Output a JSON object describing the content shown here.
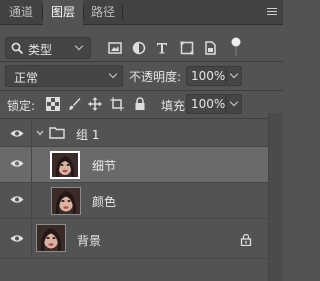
{
  "tabs": [
    {
      "label": "通道",
      "active": false
    },
    {
      "label": "图层",
      "active": true
    },
    {
      "label": "路径",
      "active": false
    }
  ],
  "filter": {
    "kind_label": "类型",
    "icons": [
      "image-filter-icon",
      "adjustment-filter-icon",
      "type-filter-icon",
      "shape-filter-icon",
      "smart-object-filter-icon",
      "filter-toggle-icon"
    ]
  },
  "blend": {
    "mode": "正常",
    "opacity_label": "不透明度:",
    "opacity_value": "100%"
  },
  "lock": {
    "label": "锁定:",
    "icons": [
      "lock-transparent-icon",
      "lock-image-icon",
      "lock-position-icon",
      "lock-artboard-icon",
      "lock-all-icon"
    ],
    "fill_label": "填充:",
    "fill_value": "100%"
  },
  "layers": [
    {
      "name": "组 1",
      "type": "group",
      "visible": true,
      "expanded": true
    },
    {
      "name": "细节",
      "type": "image",
      "visible": true,
      "selected": true,
      "child": true
    },
    {
      "name": "颜色",
      "type": "image",
      "visible": true,
      "child": true
    },
    {
      "name": "背景",
      "type": "image",
      "visible": true,
      "locked": true
    }
  ]
}
